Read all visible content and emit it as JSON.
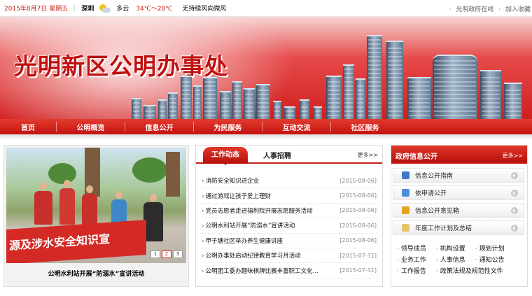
{
  "topbar": {
    "date": "2015年8月7日 星期五",
    "city": "深圳",
    "weather": "多云",
    "temperature": "34℃～28℃",
    "tagline": "无持续风向微风",
    "links": [
      "光明政府在线",
      "加入收藏"
    ]
  },
  "banner": {
    "title": "光明新区公明办事处"
  },
  "nav": [
    "首页",
    "公明概览",
    "信息公开",
    "为民服务",
    "互动交流",
    "社区服务"
  ],
  "slideshow": {
    "banner_text": "源及涉水安全知识宣",
    "caption": "公明水利站开展“防溺水”宣讲活动",
    "pages": [
      "1",
      "2",
      "3"
    ],
    "active_page": "2"
  },
  "news": {
    "tabs": [
      "工作动态",
      "人事招聘"
    ],
    "more": "更多>>",
    "items": [
      {
        "title": "消防安全知识进企业",
        "date": "[2015-08-06]"
      },
      {
        "title": "通过游戏让孩子爱上理财",
        "date": "[2015-08-06]"
      },
      {
        "title": "党员志愿者走进福利院开展志愿服务活动",
        "date": "[2015-08-06]"
      },
      {
        "title": "公明水利站开展“防溺水”宣讲活动",
        "date": "[2015-08-06]"
      },
      {
        "title": "甲子塘社区举办养生健康讲座",
        "date": "[2015-08-06]"
      },
      {
        "title": "公明办事处启动纪律教育学习月活动",
        "date": "[2015-07-31]"
      },
      {
        "title": "公明团工委办趣味棋牌比赛丰富职工文化...",
        "date": "[2015-07-31]"
      }
    ]
  },
  "gov": {
    "title": "政府信息公开",
    "more": "更多>>",
    "buttons": [
      {
        "label": "信息公开指南",
        "icon": "guide-icon",
        "color": "#3b7cc4"
      },
      {
        "label": "依申请公开",
        "icon": "list-icon",
        "color": "#4a8fd6"
      },
      {
        "label": "信息公开意见箱",
        "icon": "pencil-note-icon",
        "color": "#e6a21f"
      },
      {
        "label": "年度工作计划及总结",
        "icon": "folder-icon",
        "color": "#e8c36a"
      }
    ],
    "links": [
      [
        "领导成员",
        "机构设置",
        "规划计划"
      ],
      [
        "业务工作",
        "人事信息",
        "通知公告"
      ],
      [
        "工作报告",
        "政策法规及规范性文件"
      ]
    ]
  },
  "colors": {
    "accent": "#c8201c",
    "nav": "#d11f1f"
  }
}
